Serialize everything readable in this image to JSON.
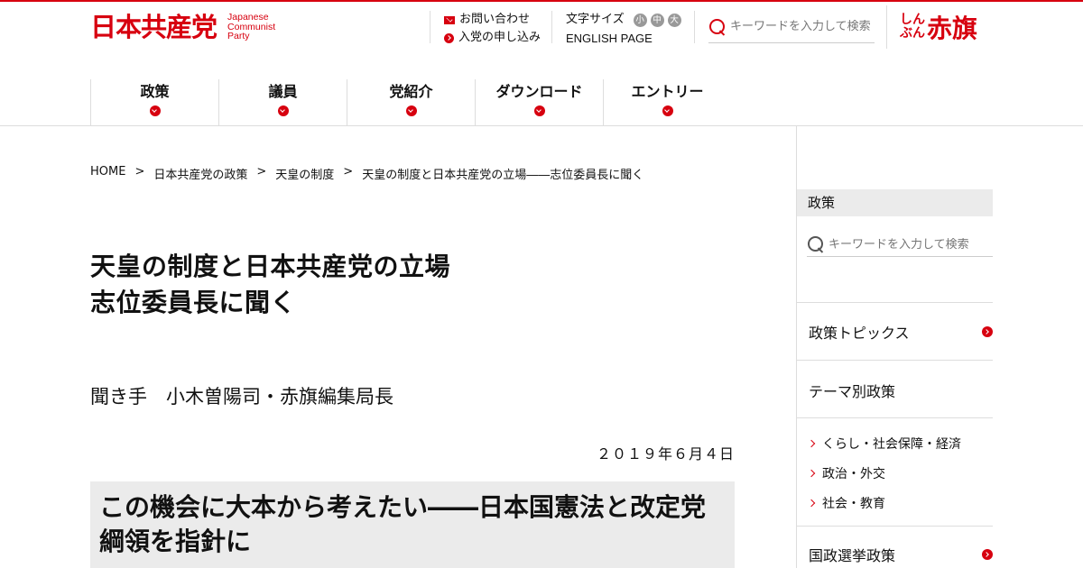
{
  "header": {
    "logo_jp": "日本共産党",
    "logo_en": [
      "Japanese",
      "Communist",
      "Party"
    ],
    "contact": "お問い合わせ",
    "join": "入党の申し込み",
    "font_size_label": "文字サイズ",
    "font_sizes": [
      "小",
      "中",
      "大"
    ],
    "english": "ENGLISH PAGE",
    "search_placeholder": "キーワードを入力して検索",
    "akahata_kana": [
      "しん",
      "ぶん"
    ],
    "akahata_kanji": "赤旗"
  },
  "nav": {
    "items": [
      {
        "label": "政策"
      },
      {
        "label": "議員"
      },
      {
        "label": "党紹介"
      },
      {
        "label": "ダウンロード"
      },
      {
        "label": "エントリー"
      }
    ]
  },
  "breadcrumb": {
    "items": [
      "HOME",
      "日本共産党の政策",
      "天皇の制度",
      "天皇の制度と日本共産党の立場――志位委員長に聞く"
    ],
    "separator": ">"
  },
  "article": {
    "title_line1": "天皇の制度と日本共産党の立場",
    "title_line2": "志位委員長に聞く",
    "interviewer": "聞き手　小木曽陽司・赤旗編集局長",
    "date": "２０１９年６月４日",
    "section_heading": "この機会に大本から考えたい――日本国憲法と改定党綱領を指針に"
  },
  "sidebar": {
    "title": "政策",
    "search_placeholder": "キーワードを入力して検索",
    "links": [
      {
        "label": "政策トピックス",
        "arrow": true
      },
      {
        "label": "テーマ別政策",
        "arrow": false
      }
    ],
    "sub_items": [
      "くらし・社会保障・経済",
      "政治・外交",
      "社会・教育"
    ],
    "link_bottom": "国政選挙政策"
  },
  "colors": {
    "accent": "#d7000f",
    "panel_bg": "#ebebeb",
    "divider": "#dddddd"
  }
}
